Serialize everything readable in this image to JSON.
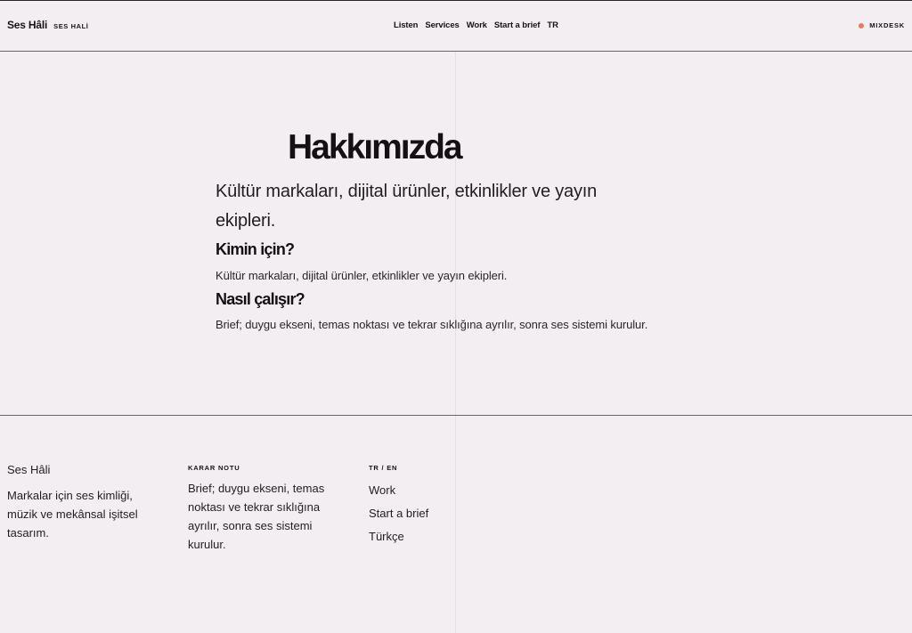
{
  "header": {
    "brand_name": "Ses Hâli",
    "brand_small": "SES HALİ",
    "nav": [
      {
        "label": "Listen"
      },
      {
        "label": "Services"
      },
      {
        "label": "Work"
      },
      {
        "label": "Start a brief"
      },
      {
        "label": "TR"
      }
    ],
    "status_label": "MIXDESK",
    "status_color": "#f07a55"
  },
  "main": {
    "title": "Hakkımızda",
    "lead": "Kültür markaları, dijital ürünler, etkinlikler ve yayın ekipleri.",
    "sections": [
      {
        "heading": "Kimin için?",
        "body": "Kültür markaları, dijital ürünler, etkinlikler ve yayın ekipleri."
      },
      {
        "heading": "Nasıl çalışır?",
        "body": "Brief; duygu ekseni, temas noktası ve tekrar sıklığına ayrılır, sonra ses sistemi kurulur."
      }
    ]
  },
  "footer": {
    "brand": "Ses Hâli",
    "description": "Markalar için ses kimliği, müzik ve mekânsal işitsel tasarım.",
    "note_label": "KARAR NOTU",
    "note_text": "Brief; duygu ekseni, temas noktası ve tekrar sıklığına ayrılır, sonra ses sistemi kurulur.",
    "links_label": "TR / EN",
    "links": [
      {
        "label": "Work"
      },
      {
        "label": "Start a brief"
      },
      {
        "label": "Türkçe"
      }
    ]
  }
}
